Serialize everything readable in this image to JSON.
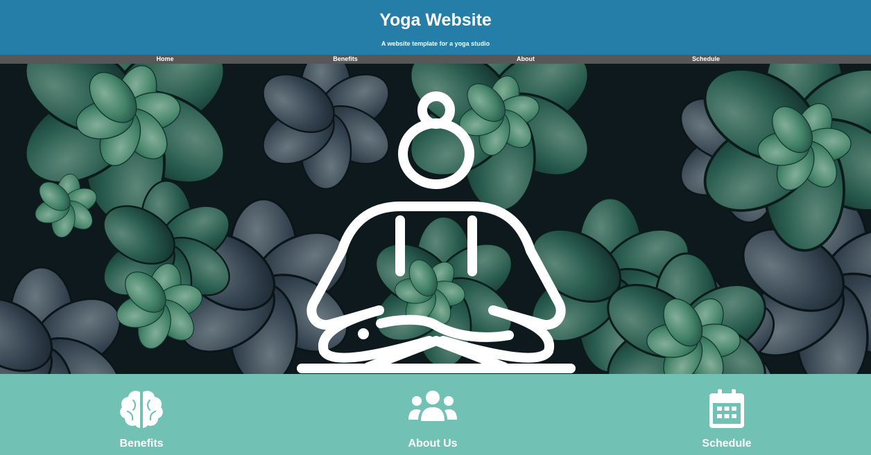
{
  "header": {
    "title": "Yoga Website",
    "subtitle": "A website template for a yoga studio"
  },
  "nav": {
    "items": [
      {
        "label": "Home"
      },
      {
        "label": "Benefits"
      },
      {
        "label": "About"
      },
      {
        "label": "Schedule"
      }
    ]
  },
  "hero": {
    "background": "succulent-plants-photo",
    "icon": "meditation-pose-icon"
  },
  "features": {
    "items": [
      {
        "label": "Benefits",
        "icon": "brain-icon"
      },
      {
        "label": "About Us",
        "icon": "users-icon"
      },
      {
        "label": "Schedule",
        "icon": "calendar-icon"
      }
    ]
  },
  "colors": {
    "header_bg": "#257ea8",
    "nav_bg": "#575757",
    "features_bg": "#71c2b4",
    "text": "#ffffff"
  }
}
